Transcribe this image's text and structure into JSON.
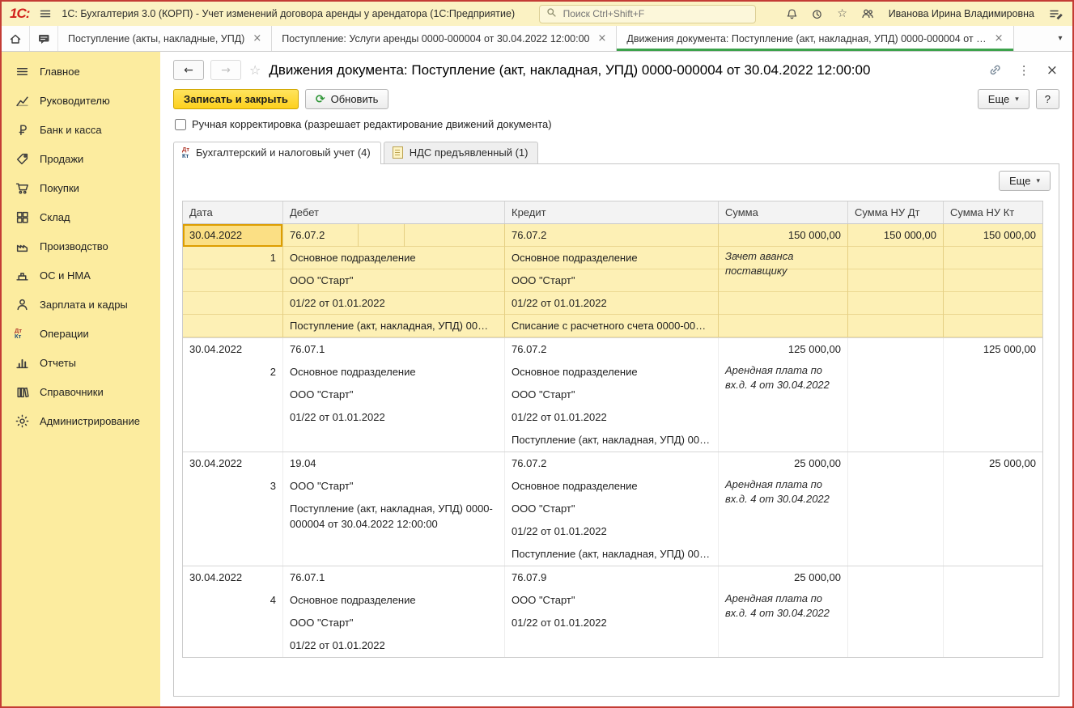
{
  "titlebar": {
    "logo": "1С:",
    "app_title": "1С: Бухгалтерия 3.0 (КОРП) - Учет изменений договора аренды у арендатора  (1С:Предприятие)",
    "search_placeholder": "Поиск Ctrl+Shift+F",
    "user_name": "Иванова Ирина Владимировна"
  },
  "icons": {
    "dropdown": "▾",
    "close": "×",
    "back": "←",
    "forward": "→",
    "star": "☆",
    "kebab": "⋮",
    "refresh": "⟳"
  },
  "window_tabs": {
    "items": [
      {
        "label": "Поступление (акты, накладные, УПД)"
      },
      {
        "label": "Поступление: Услуги аренды 0000-000004 от 30.04.2022 12:00:00"
      },
      {
        "label": "Движения документа: Поступление (акт, накладная, УПД) 0000-000004 от …"
      }
    ]
  },
  "sidebar": {
    "items": [
      {
        "label": "Главное",
        "icon": "menu-icon"
      },
      {
        "label": "Руководителю",
        "icon": "chart-icon"
      },
      {
        "label": "Банк и касса",
        "icon": "ruble-icon"
      },
      {
        "label": "Продажи",
        "icon": "sales-tag-icon"
      },
      {
        "label": "Покупки",
        "icon": "cart-icon"
      },
      {
        "label": "Склад",
        "icon": "warehouse-icon"
      },
      {
        "label": "Производство",
        "icon": "production-icon"
      },
      {
        "label": "ОС и НМА",
        "icon": "machine-icon"
      },
      {
        "label": "Зарплата и кадры",
        "icon": "person-icon"
      },
      {
        "label": "Операции",
        "icon": "dtkt-icon"
      },
      {
        "label": "Отчеты",
        "icon": "bar-chart-icon"
      },
      {
        "label": "Справочники",
        "icon": "books-icon"
      },
      {
        "label": "Администрирование",
        "icon": "gear-icon"
      }
    ]
  },
  "page": {
    "title": "Движения документа: Поступление (акт, накладная, УПД) 0000-000004 от 30.04.2022 12:00:00",
    "toolbar": {
      "save_close": "Записать и закрыть",
      "refresh": "Обновить",
      "more": "Еще",
      "help": "?"
    },
    "manual_correction_label": "Ручная корректировка (разрешает редактирование движений документа)",
    "doc_tabs": [
      {
        "label": "Бухгалтерский и налоговый учет (4)"
      },
      {
        "label": "НДС предъявленный (1)"
      }
    ]
  },
  "table": {
    "headers": [
      "Дата",
      "Дебет",
      "Кредит",
      "Сумма",
      "Сумма НУ Дт",
      "Сумма НУ Кт"
    ],
    "rows": [
      {
        "date": "30.04.2022",
        "num": "1",
        "debit": [
          "76.07.2",
          "Основное подразделение",
          "ООО \"Старт\"",
          "01/22 от 01.01.2022",
          "Поступление (акт, накладная, УПД) 00…"
        ],
        "credit": [
          "76.07.2",
          "Основное подразделение",
          "ООО \"Старт\"",
          "01/22 от 01.01.2022",
          "Списание с расчетного счета 0000-00…"
        ],
        "amount": "150 000,00",
        "note": "Зачет аванса поставщику",
        "amount_nu_dt": "150 000,00",
        "amount_nu_kt": "150 000,00"
      },
      {
        "date": "30.04.2022",
        "num": "2",
        "debit": [
          "76.07.1",
          "Основное подразделение",
          "ООО \"Старт\"",
          "01/22 от 01.01.2022"
        ],
        "credit": [
          "76.07.2",
          "Основное подразделение",
          "ООО \"Старт\"",
          "01/22 от 01.01.2022",
          "Поступление (акт, накладная, УПД) 00…"
        ],
        "amount": "125 000,00",
        "note": "Арендная плата по вх.д. 4 от 30.04.2022",
        "amount_nu_dt": "",
        "amount_nu_kt": "125 000,00"
      },
      {
        "date": "30.04.2022",
        "num": "3",
        "debit": [
          "19.04",
          "ООО \"Старт\"",
          "Поступление (акт, накладная, УПД) 0000-000004 от 30.04.2022 12:00:00"
        ],
        "credit": [
          "76.07.2",
          "Основное подразделение",
          "ООО \"Старт\"",
          "01/22 от 01.01.2022",
          "Поступление (акт, накладная, УПД) 00…"
        ],
        "amount": "25 000,00",
        "note": "Арендная плата по вх.д. 4 от 30.04.2022",
        "amount_nu_dt": "",
        "amount_nu_kt": "25 000,00"
      },
      {
        "date": "30.04.2022",
        "num": "4",
        "debit": [
          "76.07.1",
          "Основное подразделение",
          "ООО \"Старт\"",
          "01/22 от 01.01.2022"
        ],
        "credit": [
          "76.07.9",
          "ООО \"Старт\"",
          "01/22 от 01.01.2022"
        ],
        "amount": "25 000,00",
        "note": "Арендная плата по вх.д. 4 от 30.04.2022",
        "amount_nu_dt": "",
        "amount_nu_kt": ""
      }
    ]
  }
}
